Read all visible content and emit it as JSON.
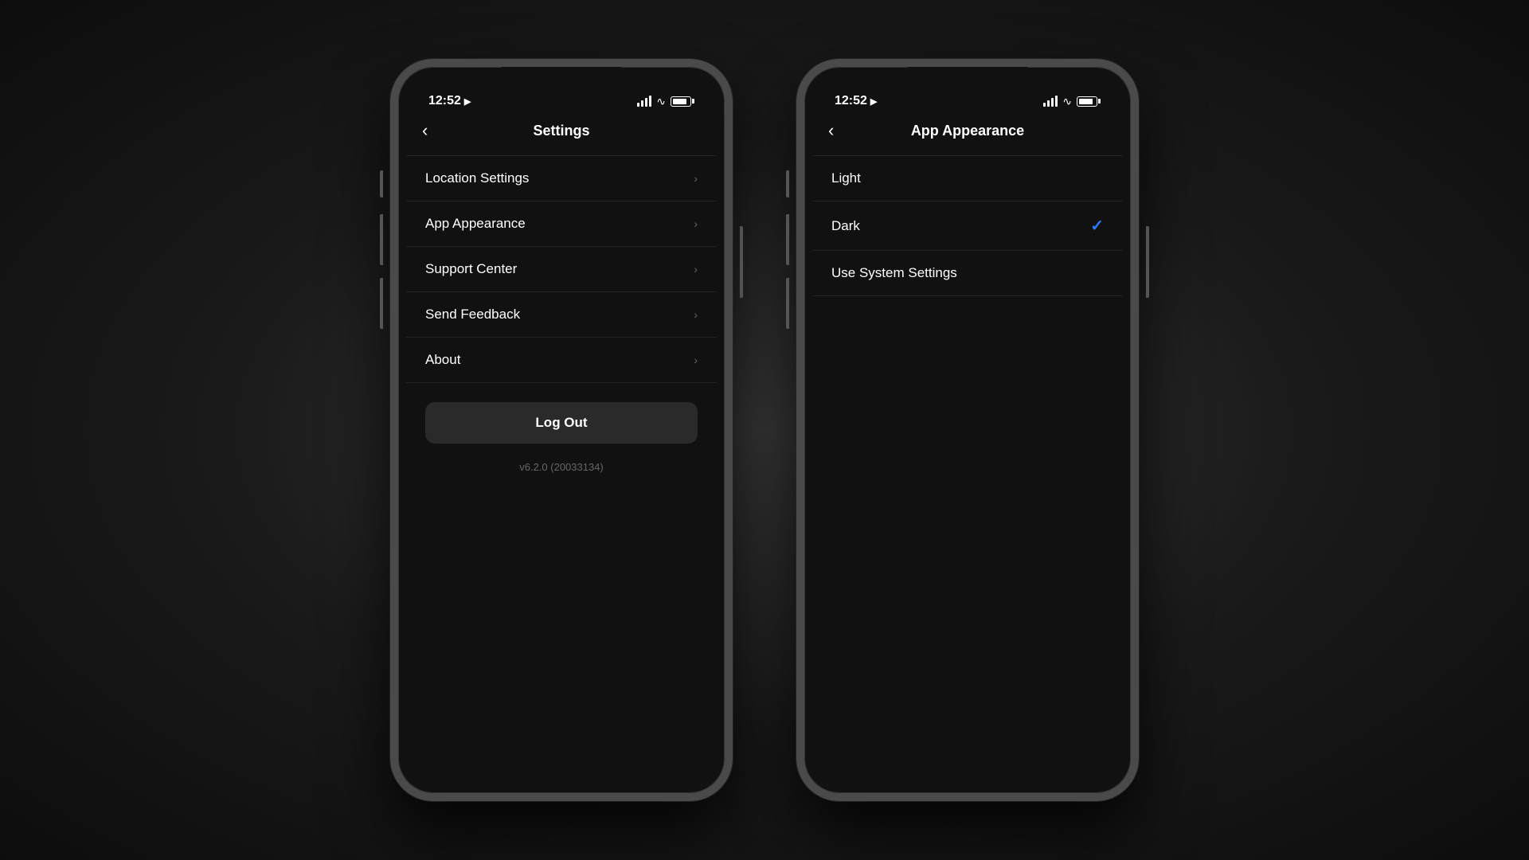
{
  "phone1": {
    "statusBar": {
      "time": "12:52",
      "locationIcon": "▶",
      "batteryLevel": 85
    },
    "navTitle": "Settings",
    "backButton": "‹",
    "menuItems": [
      {
        "label": "Location Settings",
        "hasChevron": true
      },
      {
        "label": "App Appearance",
        "hasChevron": true
      },
      {
        "label": "Support Center",
        "hasChevron": true
      },
      {
        "label": "Send Feedback",
        "hasChevron": true
      },
      {
        "label": "About",
        "hasChevron": true
      }
    ],
    "logoutButton": "Log Out",
    "versionText": "v6.2.0 (20033134)"
  },
  "phone2": {
    "statusBar": {
      "time": "12:52",
      "locationIcon": "▶",
      "batteryLevel": 85
    },
    "navTitle": "App Appearance",
    "backButton": "‹",
    "appearanceItems": [
      {
        "label": "Light",
        "selected": false
      },
      {
        "label": "Dark",
        "selected": true
      },
      {
        "label": "Use System Settings",
        "selected": false
      }
    ],
    "checkmark": "✓",
    "checkmarkColor": "#2979ff"
  }
}
